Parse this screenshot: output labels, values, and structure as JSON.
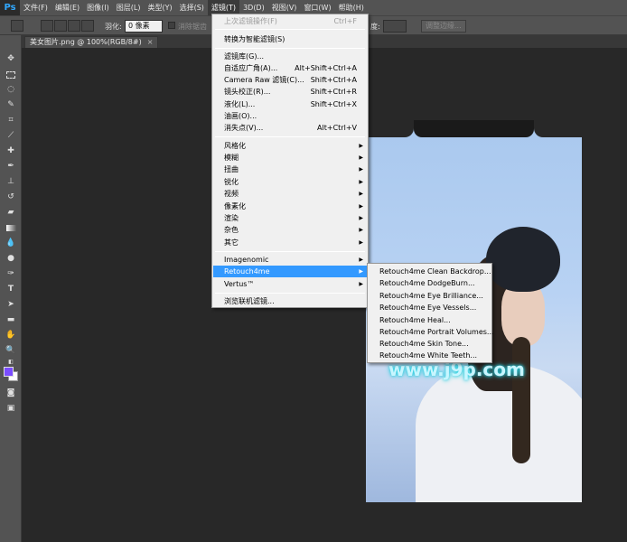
{
  "app": {
    "logo": "Ps"
  },
  "menubar": {
    "items": [
      "文件(F)",
      "编辑(E)",
      "图像(I)",
      "图层(L)",
      "类型(Y)",
      "选择(S)",
      "滤镜(T)",
      "3D(D)",
      "视图(V)",
      "窗口(W)",
      "帮助(H)"
    ],
    "active_index": 6
  },
  "options_bar": {
    "feather_label": "羽化:",
    "feather_value": "0 像素",
    "antialias_label": "消除锯齿",
    "style_tail": "度:",
    "refine_edge_button": "调整边缘..."
  },
  "document": {
    "tab_title": "美女图片.png @ 100%(RGB/8#)",
    "tab_close": "×"
  },
  "filter_menu": {
    "items": [
      {
        "label": "上次滤镜操作(F)",
        "shortcut": "Ctrl+F",
        "disabled": true
      },
      {
        "label": "转换为智能滤镜(S)"
      },
      {
        "label": "滤镜库(G)..."
      },
      {
        "label": "自适应广角(A)...",
        "shortcut": "Alt+Shift+Ctrl+A"
      },
      {
        "label": "Camera Raw 滤镜(C)...",
        "shortcut": "Shift+Ctrl+A"
      },
      {
        "label": "镜头校正(R)...",
        "shortcut": "Shift+Ctrl+R"
      },
      {
        "label": "液化(L)...",
        "shortcut": "Shift+Ctrl+X"
      },
      {
        "label": "油画(O)..."
      },
      {
        "label": "消失点(V)...",
        "shortcut": "Alt+Ctrl+V"
      },
      {
        "label": "风格化",
        "submenu": true
      },
      {
        "label": "模糊",
        "submenu": true
      },
      {
        "label": "扭曲",
        "submenu": true
      },
      {
        "label": "锐化",
        "submenu": true
      },
      {
        "label": "视频",
        "submenu": true
      },
      {
        "label": "像素化",
        "submenu": true
      },
      {
        "label": "渲染",
        "submenu": true
      },
      {
        "label": "杂色",
        "submenu": true
      },
      {
        "label": "其它",
        "submenu": true
      },
      {
        "label": "Imagenomic",
        "submenu": true
      },
      {
        "label": "Retouch4me",
        "submenu": true,
        "highlighted": true
      },
      {
        "label": "Vertus™",
        "submenu": true
      },
      {
        "label": "浏览联机滤镜..."
      }
    ],
    "arrow_glyph": "▶"
  },
  "retouch_submenu": {
    "items": [
      "Retouch4me Clean Backdrop...",
      "Retouch4me DodgeBurn...",
      "Retouch4me Eye Brilliance...",
      "Retouch4me Eye Vessels...",
      "Retouch4me Heal...",
      "Retouch4me Portrait Volumes...",
      "Retouch4me Skin Tone...",
      "Retouch4me White Teeth..."
    ]
  },
  "watermark": {
    "text": "www.j9p.com"
  },
  "colors": {
    "foreground": "#7b4dff",
    "background": "#ffffff",
    "highlight": "#3399ff"
  },
  "tools": [
    "move-tool",
    "marquee-tool",
    "lasso-tool",
    "quick-select-tool",
    "crop-tool",
    "eyedropper-tool",
    "healing-brush-tool",
    "brush-tool",
    "clone-stamp-tool",
    "history-brush-tool",
    "eraser-tool",
    "gradient-tool",
    "blur-tool",
    "dodge-tool",
    "pen-tool",
    "type-tool",
    "path-select-tool",
    "rectangle-tool",
    "hand-tool",
    "zoom-tool"
  ]
}
